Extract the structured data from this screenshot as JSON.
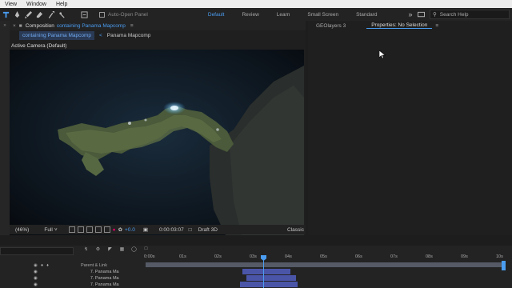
{
  "menubar": {
    "items": [
      "View",
      "Window",
      "Help"
    ]
  },
  "toolbar": {
    "auto_open_panel": "Auto-Open Panel",
    "workspaces": [
      "Default",
      "Review",
      "Learn",
      "Small Screen",
      "Standard"
    ],
    "selected_workspace": "Default",
    "overflow": "»",
    "search_placeholder": "Search Help"
  },
  "composition": {
    "close": "×",
    "tab_prefix": "Composition",
    "tab_name": "containing Panama Mapcomp",
    "flow_current": "containing Panama Mapcomp",
    "flow_sep": "<",
    "flow_next": "Panama Mapcomp",
    "camera": "Active Camera (Default)",
    "zoom": "(46%)",
    "resolution": "Full",
    "exposure": "+0.0",
    "timecode": "0:00:03:07",
    "draft": "Draft 3D",
    "renderer": "Classic"
  },
  "right_panel": {
    "tabs": [
      "GEOlayers 3",
      "Properties: No Selection"
    ],
    "selected_tab": "Properties: No Selection"
  },
  "timeline": {
    "column_header": "Parent & Link",
    "ruler_ticks": [
      "0:00s",
      "01s",
      "02s",
      "03s",
      "04s",
      "05s",
      "06s",
      "07s",
      "08s",
      "09s",
      "10s"
    ],
    "layers": [
      "7. Panama Ma",
      "7. Panama Ma",
      "7. Panama Ma"
    ]
  },
  "colors": {
    "accent": "#4a9cf0",
    "panel_bg": "#1f1f1f",
    "layer_bar": "#4a55a8"
  }
}
